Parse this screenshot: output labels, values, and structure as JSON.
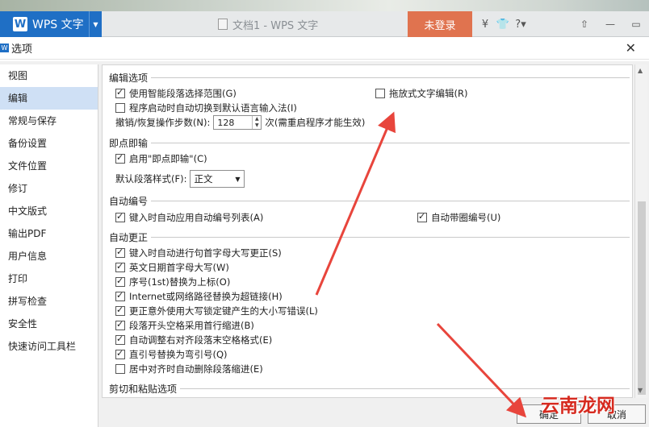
{
  "app": {
    "name": "WPS 文字",
    "logo": "W",
    "doc_title": "文档1 - WPS 文字",
    "login": "未登录",
    "help": "?"
  },
  "dialog": {
    "icon": "W",
    "title": "选项",
    "close": "✕"
  },
  "sidebar": {
    "items": [
      "视图",
      "编辑",
      "常规与保存",
      "备份设置",
      "文件位置",
      "修订",
      "中文版式",
      "输出PDF",
      "用户信息",
      "打印",
      "拼写检查",
      "安全性",
      "快速访问工具栏"
    ],
    "selected": "编辑"
  },
  "sections": {
    "edit": {
      "title": "编辑选项",
      "smart_select": "使用智能段落选择范围(G)",
      "drag_text": "拖放式文字编辑(R)",
      "switch_ime": "程序启动时自动切换到默认语言输入法(I)",
      "undo_label": "撤销/恢复操作步数(N):",
      "undo_value": "128",
      "undo_note": "次(需重启程序才能生效)"
    },
    "click_type": {
      "title": "即点即输",
      "enable": "启用\"即点即输\"(C)",
      "default_style_label": "默认段落样式(F):",
      "default_style_value": "正文"
    },
    "auto_number": {
      "title": "自动编号",
      "apply_list": "键入时自动应用自动编号列表(A)",
      "circle_number": "自动带圈编号(U)"
    },
    "autocorrect": {
      "title": "自动更正",
      "items": [
        "键入时自动进行句首字母大写更正(S)",
        "英文日期首字母大写(W)",
        "序号(1st)替换为上标(O)",
        "Internet或网络路径替换为超链接(H)",
        "更正意外使用大写锁定键产生的大小写错误(L)",
        "段落开头空格采用首行缩进(B)",
        "自动调整右对齐段落末空格格式(E)",
        "直引号替换为弯引号(Q)",
        "居中对齐时自动删除段落缩进(E)"
      ]
    },
    "cut_paste": {
      "title": "剪切和粘贴选项"
    }
  },
  "buttons": {
    "ok": "确定",
    "cancel": "取消"
  },
  "watermark": "云南龙网",
  "colors": {
    "accent": "#1f6fc5",
    "login": "#e0734f",
    "arrow": "#e8453c",
    "selected": "#cfe0f5"
  }
}
